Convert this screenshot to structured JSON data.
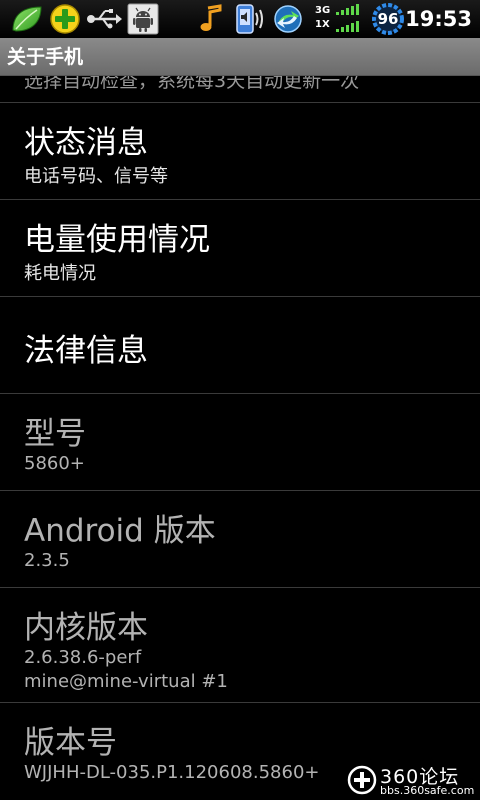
{
  "status_bar": {
    "time": "19:53",
    "battery_level": "96",
    "network_top": "3G",
    "network_bottom": "1X",
    "icons": [
      "leaf-icon",
      "plus-app-icon",
      "usb-icon",
      "android-debug-icon",
      "music-note-icon",
      "vibrate-icon",
      "sync-icon",
      "signal-icon",
      "battery-ring-icon"
    ]
  },
  "title_bar": {
    "title": "关于手机"
  },
  "list": {
    "partial_top_text": "选择自动检查，系统每3天自动更新一次",
    "items": [
      {
        "title": "状态消息",
        "subtitle": "电话号码、信号等",
        "enabled": true
      },
      {
        "title": "电量使用情况",
        "subtitle": "耗电情况",
        "enabled": true
      },
      {
        "title": "法律信息",
        "subtitle": "",
        "enabled": true
      },
      {
        "title": "型号",
        "subtitle": "5860+",
        "enabled": false
      },
      {
        "title": "Android 版本",
        "subtitle": "2.3.5",
        "enabled": false
      },
      {
        "title": "内核版本",
        "subtitle": "2.6.38.6-perf",
        "subtitle2": "mine@mine-virtual #1",
        "enabled": false
      },
      {
        "title": "版本号",
        "subtitle": "WJJHH-DL-035.P1.120608.5860+",
        "enabled": false
      }
    ]
  },
  "watermark": {
    "brand": "360论坛",
    "url": "bbs.360safe.com"
  },
  "colors": {
    "background": "#000000",
    "title_bar": "#7a7a7a",
    "divider": "#3a3a3a",
    "text_primary": "#ffffff",
    "text_disabled": "#b3b3b3"
  }
}
